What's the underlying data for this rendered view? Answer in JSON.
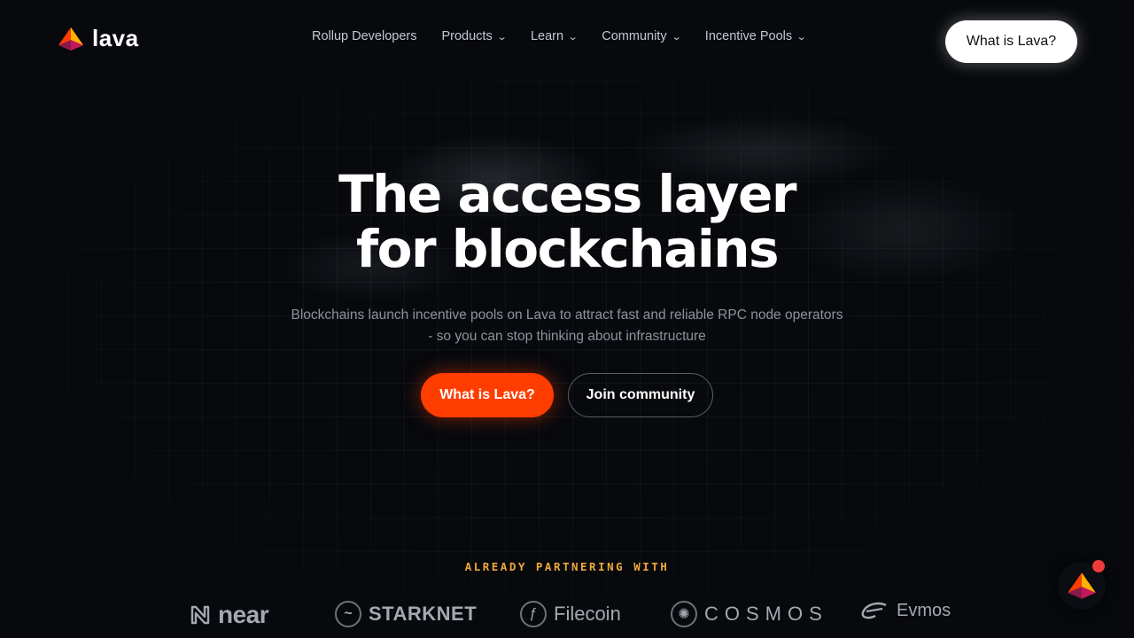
{
  "header": {
    "logo_text": "lava",
    "nav": [
      {
        "label": "Rollup Developers",
        "has_dropdown": false
      },
      {
        "label": "Products",
        "has_dropdown": true
      },
      {
        "label": "Learn",
        "has_dropdown": true
      },
      {
        "label": "Community",
        "has_dropdown": true
      },
      {
        "label": "Incentive Pools",
        "has_dropdown": true
      }
    ],
    "cta_label": "What is Lava?"
  },
  "hero": {
    "title_line1": "The access layer",
    "title_line2": "for blockchains",
    "subtitle_line1": "Blockchains launch incentive pools on Lava to attract fast and reliable RPC node operators",
    "subtitle_line2": "- so you can stop thinking about infrastructure",
    "primary_button": "What is Lava?",
    "secondary_button": "Join community"
  },
  "partners": {
    "label": "ALREADY PARTNERING WITH",
    "items": [
      {
        "name": "near",
        "icon": "near-icon"
      },
      {
        "name": "STARKNET",
        "icon": "starknet-icon"
      },
      {
        "name": "Filecoin",
        "icon": "filecoin-icon"
      },
      {
        "name": "COSMOS",
        "icon": "cosmos-icon"
      },
      {
        "name": "Evmos",
        "icon": "evmos-icon"
      }
    ]
  },
  "colors": {
    "background": "#07090d",
    "accent": "#ff3d00",
    "partner_label": "#f0a73a"
  }
}
